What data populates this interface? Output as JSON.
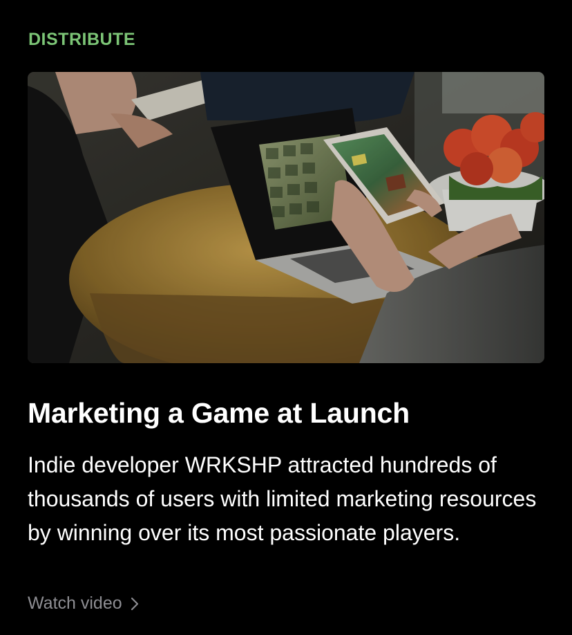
{
  "card": {
    "eyebrow": "DISTRIBUTE",
    "headline": "Marketing a Game at Launch",
    "description": "Indie developer WRKSHP attracted hundreds of thousands of users with limited marketing resources by winning over its most passionate players.",
    "cta_label": "Watch video",
    "cta_icon": "chevron-right-icon",
    "hero_image": "photo-hands-holding-phone-over-laptop-on-wooden-table"
  },
  "colors": {
    "background": "#000000",
    "eyebrow": "#7cc576",
    "headline": "#ffffff",
    "body": "#ffffff",
    "cta": "#8e8e93"
  }
}
